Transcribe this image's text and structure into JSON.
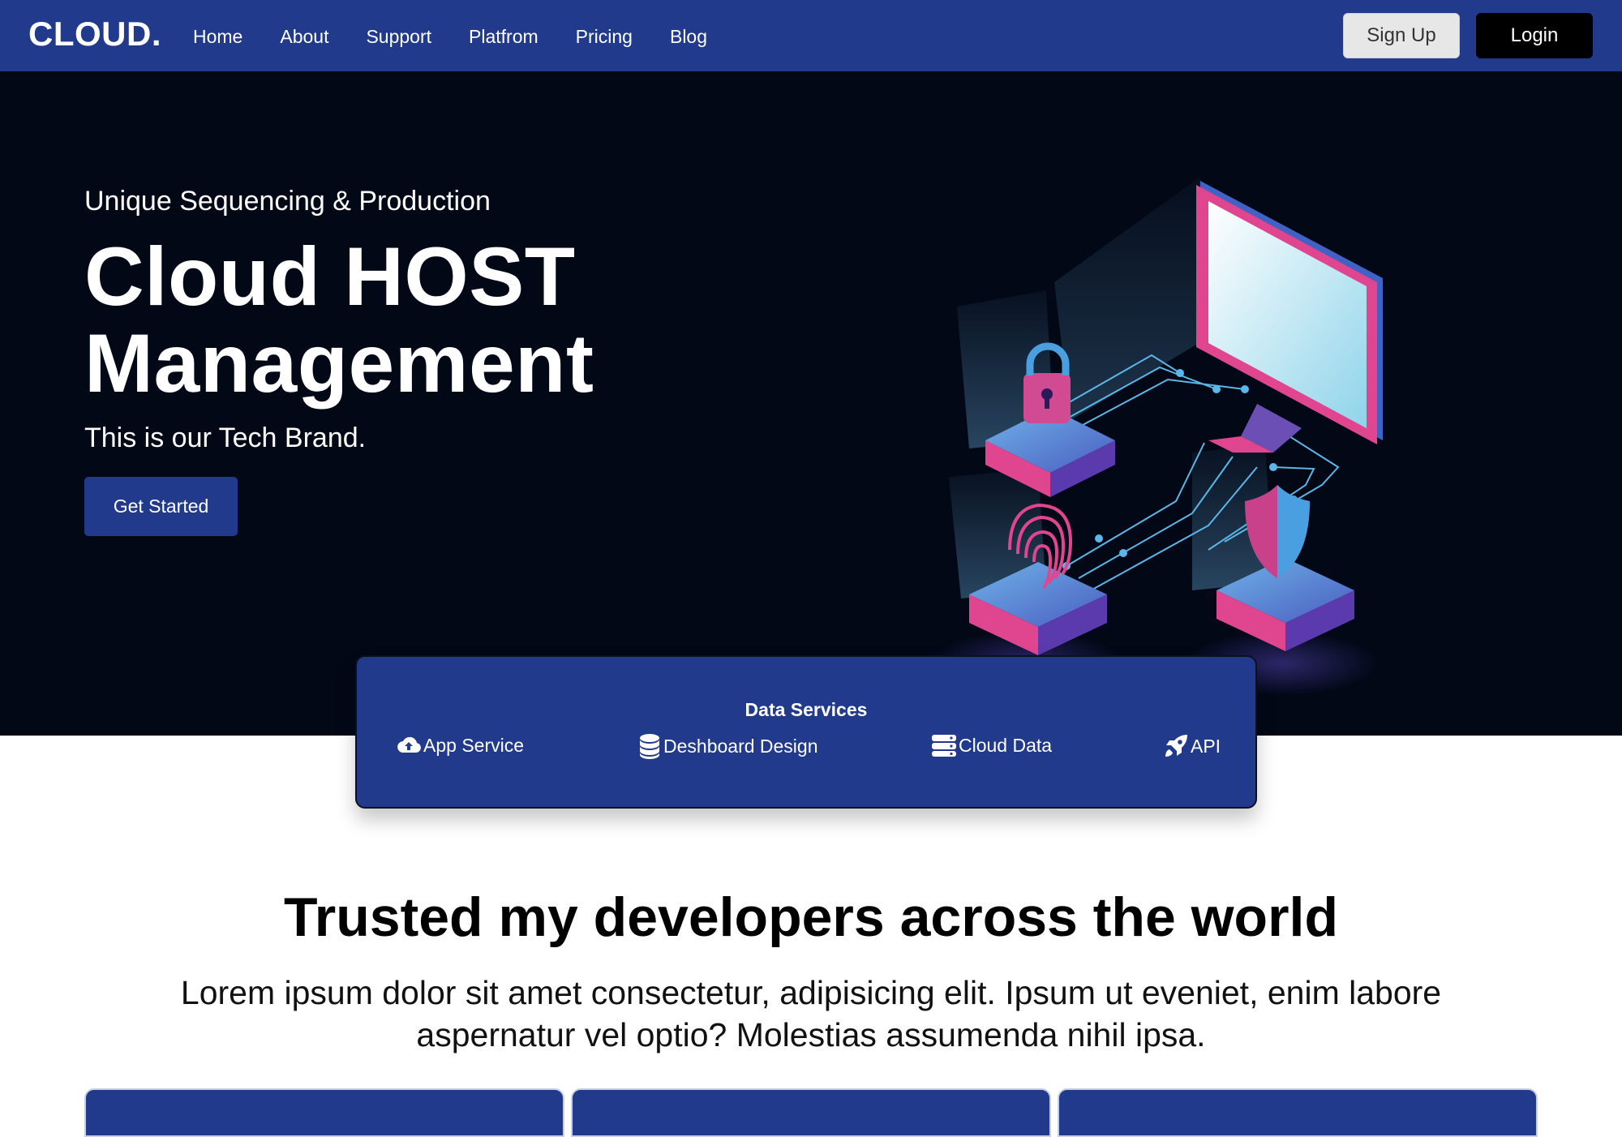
{
  "nav": {
    "logo": "CLOUD.",
    "links": [
      "Home",
      "About",
      "Support",
      "Platfrom",
      "Pricing",
      "Blog"
    ],
    "signup_label": "Sign Up",
    "login_label": "Login"
  },
  "hero": {
    "subtitle": "Unique Sequencing & Production",
    "title_line1": "Cloud HOST",
    "title_line2": "Management",
    "tagline": "This is our Tech Brand.",
    "cta_label": "Get Started"
  },
  "services": {
    "title": "Data Services",
    "items": [
      {
        "label": "App Service",
        "icon": "cloud-upload-icon"
      },
      {
        "label": "Deshboard Design",
        "icon": "database-icon"
      },
      {
        "label": "Cloud Data",
        "icon": "server-icon"
      },
      {
        "label": "API",
        "icon": "rocket-icon"
      }
    ]
  },
  "trusted": {
    "title": "Trusted my developers across the world",
    "text": "Lorem ipsum dolor sit amet consectetur, adipisicing elit. Ipsum ut eveniet, enim labore aspernatur vel optio? Molestias assumenda nihil ipsa."
  },
  "colors": {
    "brand": "#213a8b",
    "hero_bg": "#020816",
    "accent_pink": "#e0468f",
    "accent_blue": "#5ab7e8"
  }
}
